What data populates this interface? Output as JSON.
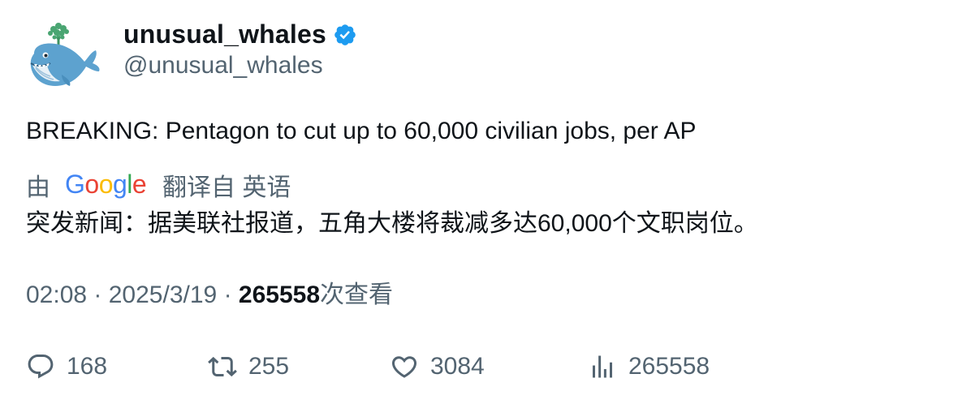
{
  "author": {
    "display_name": "unusual_whales",
    "handle": "@unusual_whales",
    "verified": true,
    "avatar_icon": "whale-icon"
  },
  "tweet": {
    "text": "BREAKING: Pentagon to cut up to 60,000 civilian jobs, per AP"
  },
  "translation": {
    "by_label": "由",
    "provider": "Google",
    "from_label": "翻译自 英语",
    "text": "突发新闻：据美联社报道，五角大楼将裁减多达60,000个文职岗位。"
  },
  "meta": {
    "time": "02:08",
    "separator": "·",
    "date": "2025/3/19",
    "views_count": "265558",
    "views_label": "次查看"
  },
  "actions": {
    "replies": "168",
    "retweets": "255",
    "likes": "3084",
    "views": "265558"
  },
  "colors": {
    "text_primary": "#0f1419",
    "text_secondary": "#536471",
    "verified_blue": "#1d9bf0"
  }
}
